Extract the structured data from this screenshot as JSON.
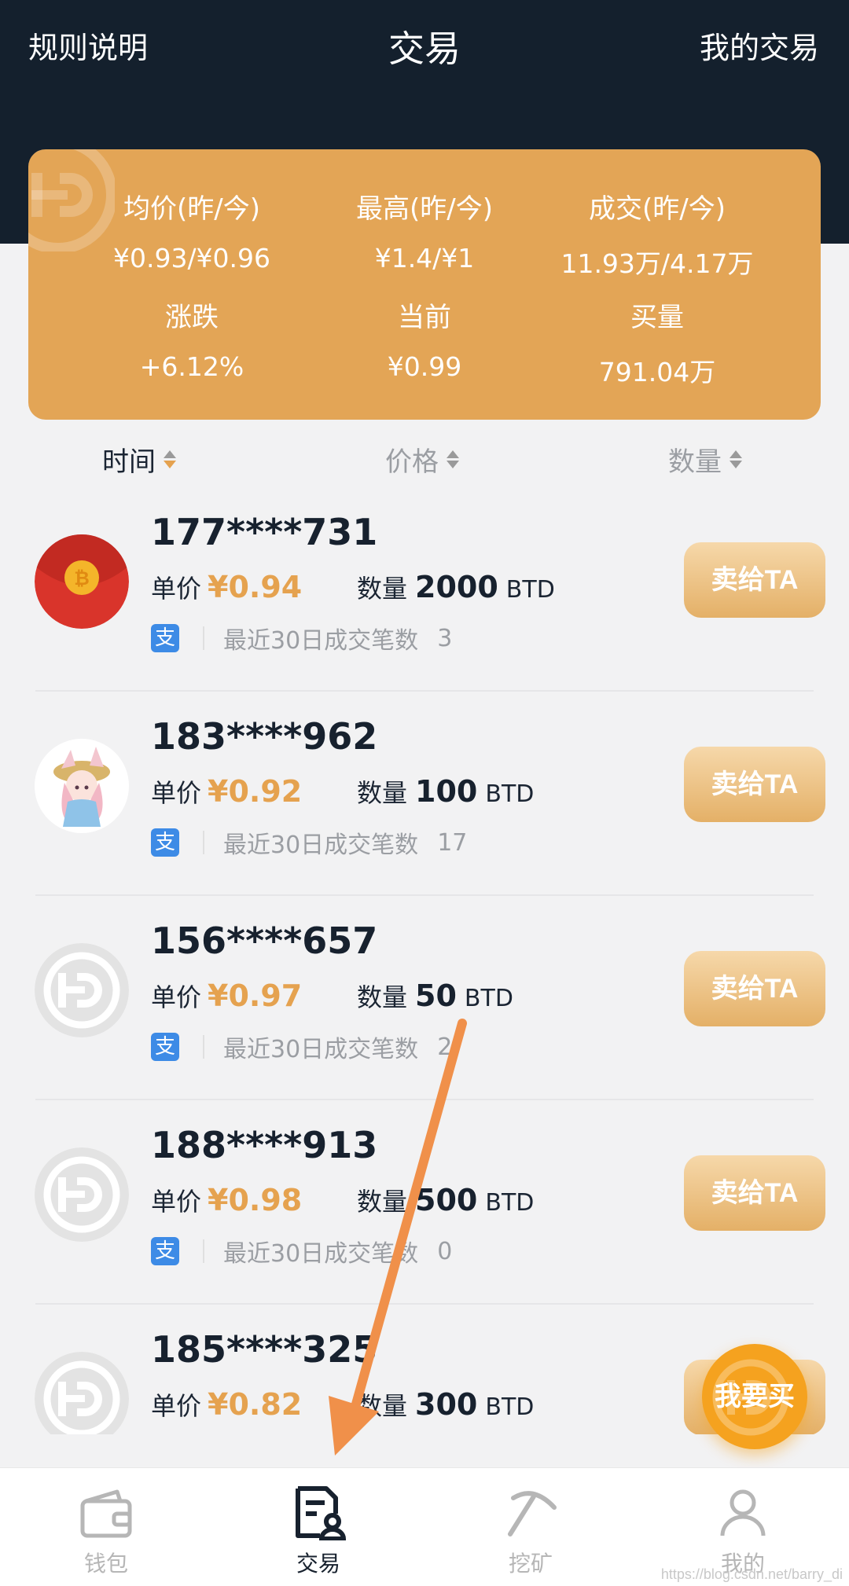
{
  "header": {
    "left": "规则说明",
    "title": "交易",
    "right": "我的交易"
  },
  "stats": [
    {
      "label": "均价(昨/今)",
      "value": "¥0.93/¥0.96"
    },
    {
      "label": "最高(昨/今)",
      "value": "¥1.4/¥1"
    },
    {
      "label": "成交(昨/今)",
      "value": "11.93万/4.17万"
    },
    {
      "label": "涨跌",
      "value": "+6.12%"
    },
    {
      "label": "当前",
      "value": "¥0.99"
    },
    {
      "label": "买量",
      "value": "791.04万"
    }
  ],
  "sort": {
    "time": "时间",
    "price": "价格",
    "qty": "数量"
  },
  "labels": {
    "unit_price": "单价",
    "quantity": "数量",
    "unit": "BTD",
    "recent": "最近30日成交笔数",
    "sell": "卖给TA",
    "pay_icon": "支"
  },
  "orders": [
    {
      "phone": "177****731",
      "price": "¥0.94",
      "qty": "2000",
      "count": "3",
      "avatar": "red-envelope"
    },
    {
      "phone": "183****962",
      "price": "¥0.92",
      "qty": "100",
      "count": "17",
      "avatar": "anime-girl"
    },
    {
      "phone": "156****657",
      "price": "¥0.97",
      "qty": "50",
      "count": "2",
      "avatar": "default-logo"
    },
    {
      "phone": "188****913",
      "price": "¥0.98",
      "qty": "500",
      "count": "0",
      "avatar": "default-logo"
    },
    {
      "phone": "185****325",
      "price": "¥0.82",
      "qty": "300",
      "count": "",
      "avatar": "default-logo"
    }
  ],
  "fab": {
    "label": "我要买"
  },
  "tabs": [
    {
      "label": "钱包",
      "icon": "wallet-icon"
    },
    {
      "label": "交易",
      "icon": "trade-icon"
    },
    {
      "label": "挖矿",
      "icon": "pickaxe-icon"
    },
    {
      "label": "我的",
      "icon": "user-icon"
    }
  ],
  "watermark": "https://blog.csdn.net/barry_di",
  "colors": {
    "header": "#14202d",
    "card": "#e3a556",
    "accent": "#e5a24f",
    "fab": "#f5a21f",
    "annotation_arrow": "#f0904a"
  }
}
